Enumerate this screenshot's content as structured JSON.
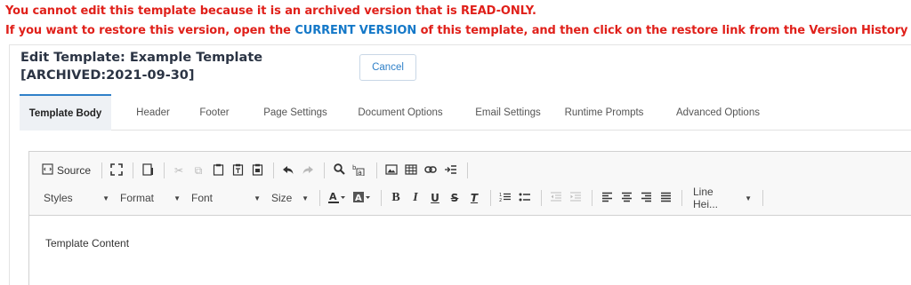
{
  "warning": {
    "line1": "You cannot edit this template because it is an archived version that is READ-ONLY.",
    "line2_prefix": "If you want to restore this version, open the ",
    "line2_link": "CURRENT VERSION",
    "line2_suffix": " of this template, and then click on the restore link from the Version History list."
  },
  "header": {
    "title": "Edit Template: Example Template [ARCHIVED:2021-09-30]",
    "cancel_label": "Cancel"
  },
  "tabs": [
    {
      "label": "Template Body",
      "active": true
    },
    {
      "label": "Header"
    },
    {
      "label": "Footer"
    },
    {
      "label": "Page Settings"
    },
    {
      "label": "Document Options"
    },
    {
      "label": "Email Settings"
    },
    {
      "label": "Runtime Prompts"
    },
    {
      "label": "Advanced Options"
    }
  ],
  "toolbar": {
    "source_label": "Source",
    "combos": {
      "styles": "Styles",
      "format": "Format",
      "font": "Font",
      "size": "Size",
      "line_height": "Line Hei..."
    },
    "buttons": {
      "bold": "B",
      "italic": "I",
      "underline": "U",
      "strike": "S",
      "remove_format": "T"
    }
  },
  "editor": {
    "content": "Template Content"
  },
  "colors": {
    "warning": "#e0201a",
    "link": "#1478c8",
    "accent": "#2f80c8"
  }
}
